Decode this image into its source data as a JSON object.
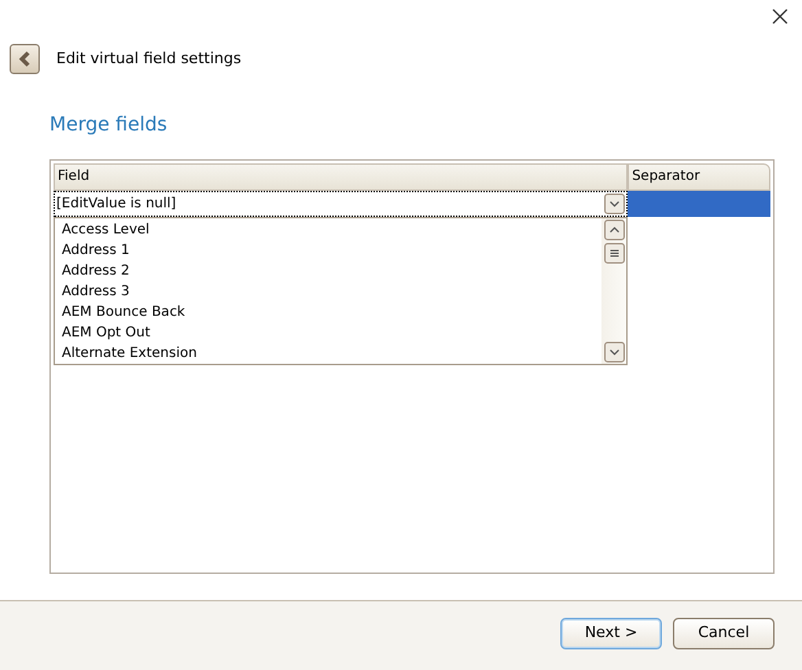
{
  "header": {
    "title": "Edit virtual field settings"
  },
  "section_title": "Merge fields",
  "grid": {
    "columns": [
      "Field",
      "Separator"
    ],
    "rows": [
      {
        "field": "[EditValue is null]",
        "separator_selected": true
      }
    ],
    "dropdown": {
      "expanded": true,
      "items": [
        "Access Level",
        "Address 1",
        "Address 2",
        "Address 3",
        "AEM Bounce Back",
        "AEM Opt Out",
        "Alternate Extension"
      ]
    }
  },
  "buttons": [
    {
      "label": "Next >",
      "default": true
    },
    {
      "label": "Cancel",
      "default": false
    }
  ]
}
